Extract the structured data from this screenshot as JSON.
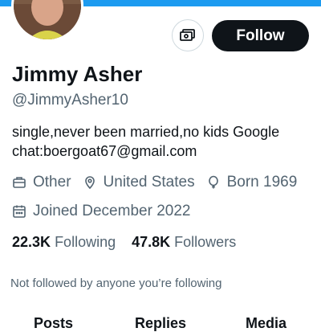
{
  "profile": {
    "name": "Jimmy Asher",
    "handle": "@JimmyAsher10",
    "bio": "single,never been married,no kids Google chat:boergoat67@gmail.com",
    "category": "Other",
    "location": "United States",
    "born": "Born 1969",
    "joined": "Joined December 2022"
  },
  "actions": {
    "follow_label": "Follow"
  },
  "stats": {
    "following_count": "22.3K",
    "following_label": "Following",
    "followers_count": "47.8K",
    "followers_label": "Followers"
  },
  "not_followed_text": "Not followed by anyone you’re following",
  "tabs": [
    "Posts",
    "Replies",
    "Media"
  ],
  "colors": {
    "accent": "#1d9bf0",
    "text": "#0f1419",
    "muted": "#536471",
    "button": "#0f1419"
  }
}
